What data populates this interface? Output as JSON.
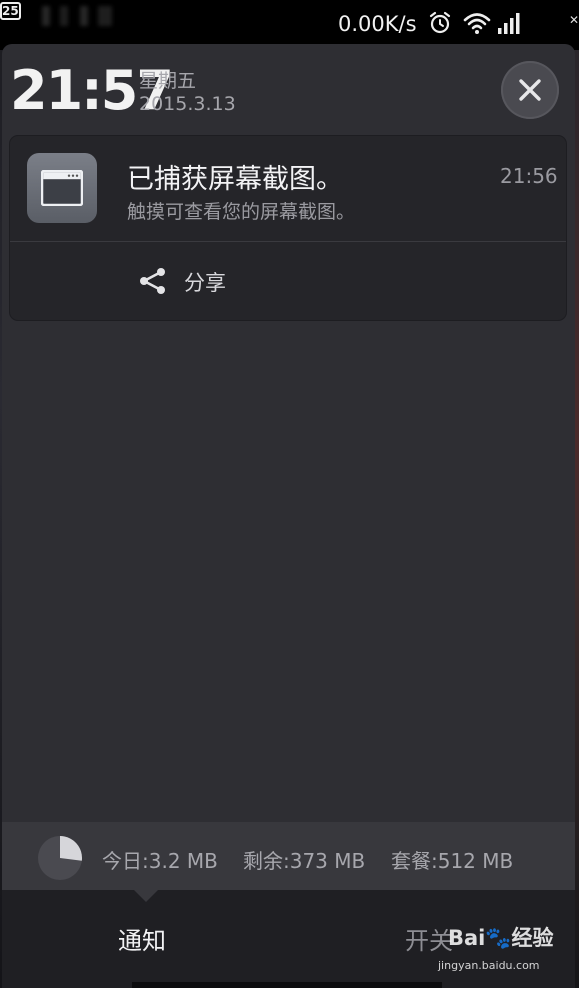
{
  "status_bar": {
    "net_speed": "0.00K/s",
    "battery": "25",
    "icons": [
      "alarm-icon",
      "wifi-icon",
      "signal-icon",
      "battery-icon"
    ]
  },
  "header": {
    "time": "21:57",
    "weekday": "星期五",
    "date": "2015.3.13"
  },
  "notification": {
    "title": "已捕获屏幕截图。",
    "body": "触摸可查看您的屏幕截图。",
    "time": "21:56",
    "action_label": "分享"
  },
  "data_usage": {
    "today": "今日:3.2 MB",
    "remaining": "剩余:373 MB",
    "plan": "套餐:512 MB",
    "used_fraction": 0.27
  },
  "tabs": [
    {
      "label": "通知",
      "active": true
    },
    {
      "label": "开关",
      "active": false
    }
  ],
  "watermark": {
    "brand": "Bai",
    "brand_suffix": "经验",
    "url": "jingyan.baidu.com"
  },
  "colors": {
    "panel": "#2e2e33",
    "card": "#252529",
    "accent_text": "#f2f2f4",
    "muted_text": "#9a9aa0"
  }
}
